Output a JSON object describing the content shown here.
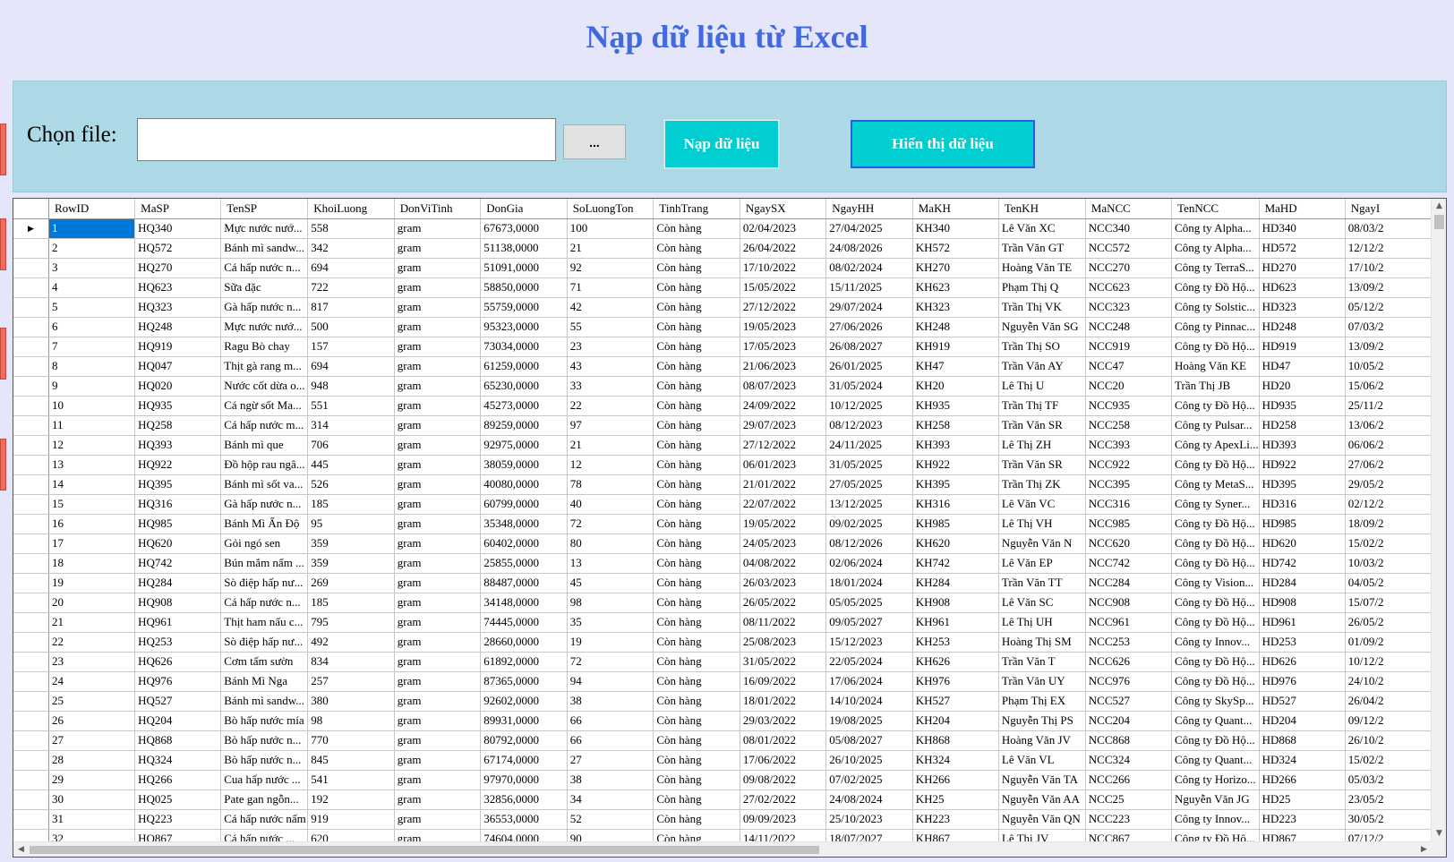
{
  "window": {
    "title": "Nạp dữ liệu từ Excel"
  },
  "file_picker": {
    "label": "Chọn file:",
    "value": "",
    "browse_label": "..."
  },
  "actions": {
    "load_label": "Nạp dữ liệu",
    "show_label": "Hiển thị dữ liệu"
  },
  "colors": {
    "background": "#e6e6fa",
    "title": "#4169e1",
    "panel": "#add8e6",
    "button": "#00ced1",
    "selection": "#0078d7"
  },
  "grid": {
    "columns": [
      "RowID",
      "MaSP",
      "TenSP",
      "KhoiLuong",
      "DonViTinh",
      "DonGia",
      "SoLuongTon",
      "TinhTrang",
      "NgaySX",
      "NgayHH",
      "MaKH",
      "TenKH",
      "MaNCC",
      "TenNCC",
      "MaHD",
      "NgayI"
    ],
    "rows": [
      [
        "1",
        "HQ340",
        "Mực nước nướ...",
        "558",
        "gram",
        "67673,0000",
        "100",
        "Còn hàng",
        "02/04/2023",
        "27/04/2025",
        "KH340",
        "Lê Văn XC",
        "NCC340",
        "Công ty Alpha...",
        "HD340",
        "08/03/2"
      ],
      [
        "2",
        "HQ572",
        "Bánh mì sandw...",
        "342",
        "gram",
        "51138,0000",
        "21",
        "Còn hàng",
        "26/04/2022",
        "24/08/2026",
        "KH572",
        "Trần Văn GT",
        "NCC572",
        "Công ty Alpha...",
        "HD572",
        "12/12/2"
      ],
      [
        "3",
        "HQ270",
        "Cá hấp nước n...",
        "694",
        "gram",
        "51091,0000",
        "92",
        "Còn hàng",
        "17/10/2022",
        "08/02/2024",
        "KH270",
        "Hoàng Văn TE",
        "NCC270",
        "Công ty TerraS...",
        "HD270",
        "17/10/2"
      ],
      [
        "4",
        "HQ623",
        "Sữa đặc",
        "722",
        "gram",
        "58850,0000",
        "71",
        "Còn hàng",
        "15/05/2022",
        "15/11/2025",
        "KH623",
        "Phạm Thị Q",
        "NCC623",
        "Công ty Đồ Hộ...",
        "HD623",
        "13/09/2"
      ],
      [
        "5",
        "HQ323",
        "Gà hấp nước n...",
        "817",
        "gram",
        "55759,0000",
        "42",
        "Còn hàng",
        "27/12/2022",
        "29/07/2024",
        "KH323",
        "Trần Thị VK",
        "NCC323",
        "Công ty Solstic...",
        "HD323",
        "05/12/2"
      ],
      [
        "6",
        "HQ248",
        "Mực nước nướ...",
        "500",
        "gram",
        "95323,0000",
        "55",
        "Còn hàng",
        "19/05/2023",
        "27/06/2026",
        "KH248",
        "Nguyễn Văn SG",
        "NCC248",
        "Công ty Pinnac...",
        "HD248",
        "07/03/2"
      ],
      [
        "7",
        "HQ919",
        "Ragu Bò chay",
        "157",
        "gram",
        "73034,0000",
        "23",
        "Còn hàng",
        "17/05/2023",
        "26/08/2027",
        "KH919",
        "Trần Thị SO",
        "NCC919",
        "Công ty Đồ Hộ...",
        "HD919",
        "13/09/2"
      ],
      [
        "8",
        "HQ047",
        "Thịt gà rang m...",
        "694",
        "gram",
        "61259,0000",
        "43",
        "Còn hàng",
        "21/06/2023",
        "26/01/2025",
        "KH47",
        "Trần Văn AY",
        "NCC47",
        "Hoàng Văn KE",
        "HD47",
        "10/05/2"
      ],
      [
        "9",
        "HQ020",
        "Nước cốt dừa o...",
        "948",
        "gram",
        "65230,0000",
        "33",
        "Còn hàng",
        "08/07/2023",
        "31/05/2024",
        "KH20",
        "Lê Thị U",
        "NCC20",
        "Trần Thị JB",
        "HD20",
        "15/06/2"
      ],
      [
        "10",
        "HQ935",
        "Cá ngừ sốt Ma...",
        "551",
        "gram",
        "45273,0000",
        "22",
        "Còn hàng",
        "24/09/2022",
        "10/12/2025",
        "KH935",
        "Trần Thị TF",
        "NCC935",
        "Công ty Đồ Hộ...",
        "HD935",
        "25/11/2"
      ],
      [
        "11",
        "HQ258",
        "Cá hấp nước m...",
        "314",
        "gram",
        "89259,0000",
        "97",
        "Còn hàng",
        "29/07/2023",
        "08/12/2023",
        "KH258",
        "Trần Văn SR",
        "NCC258",
        "Công ty Pulsar...",
        "HD258",
        "13/06/2"
      ],
      [
        "12",
        "HQ393",
        "Bánh mì que",
        "706",
        "gram",
        "92975,0000",
        "21",
        "Còn hàng",
        "27/12/2022",
        "24/11/2025",
        "KH393",
        "Lê Thị ZH",
        "NCC393",
        "Công ty ApexLi...",
        "HD393",
        "06/06/2"
      ],
      [
        "13",
        "HQ922",
        "Đồ hộp rau ngâ...",
        "445",
        "gram",
        "38059,0000",
        "12",
        "Còn hàng",
        "06/01/2023",
        "31/05/2025",
        "KH922",
        "Trần Văn SR",
        "NCC922",
        "Công ty Đồ Hộ...",
        "HD922",
        "27/06/2"
      ],
      [
        "14",
        "HQ395",
        "Bánh mì sốt va...",
        "526",
        "gram",
        "40080,0000",
        "78",
        "Còn hàng",
        "21/01/2022",
        "27/05/2025",
        "KH395",
        "Trần Thị ZK",
        "NCC395",
        "Công ty MetaS...",
        "HD395",
        "29/05/2"
      ],
      [
        "15",
        "HQ316",
        "Gà hấp nước n...",
        "185",
        "gram",
        "60799,0000",
        "40",
        "Còn hàng",
        "22/07/2022",
        "13/12/2025",
        "KH316",
        "Lê Văn VC",
        "NCC316",
        "Công ty Syner...",
        "HD316",
        "02/12/2"
      ],
      [
        "16",
        "HQ985",
        "Bánh Mì Ấn Độ",
        "95",
        "gram",
        "35348,0000",
        "72",
        "Còn hàng",
        "19/05/2022",
        "09/02/2025",
        "KH985",
        "Lê Thị VH",
        "NCC985",
        "Công ty Đồ Hộ...",
        "HD985",
        "18/09/2"
      ],
      [
        "17",
        "HQ620",
        "Gỏi ngó sen",
        "359",
        "gram",
        "60402,0000",
        "80",
        "Còn hàng",
        "24/05/2023",
        "08/12/2026",
        "KH620",
        "Nguyễn Văn N",
        "NCC620",
        "Công ty Đồ Hộ...",
        "HD620",
        "15/02/2"
      ],
      [
        "18",
        "HQ742",
        "Bún mắm nấm ...",
        "359",
        "gram",
        "25855,0000",
        "13",
        "Còn hàng",
        "04/08/2022",
        "02/06/2024",
        "KH742",
        "Lê Văn EP",
        "NCC742",
        "Công ty Đồ Hộ...",
        "HD742",
        "10/03/2"
      ],
      [
        "19",
        "HQ284",
        "Sò điệp hấp nư...",
        "269",
        "gram",
        "88487,0000",
        "45",
        "Còn hàng",
        "26/03/2023",
        "18/01/2024",
        "KH284",
        "Trần Văn TT",
        "NCC284",
        "Công ty Vision...",
        "HD284",
        "04/05/2"
      ],
      [
        "20",
        "HQ908",
        "Cá hấp nước n...",
        "185",
        "gram",
        "34148,0000",
        "98",
        "Còn hàng",
        "26/05/2022",
        "05/05/2025",
        "KH908",
        "Lê Văn SC",
        "NCC908",
        "Công ty Đồ Hộ...",
        "HD908",
        "15/07/2"
      ],
      [
        "21",
        "HQ961",
        "Thịt ham nấu c...",
        "795",
        "gram",
        "74445,0000",
        "35",
        "Còn hàng",
        "08/11/2022",
        "09/05/2027",
        "KH961",
        "Lê Thị UH",
        "NCC961",
        "Công ty Đồ Hộ...",
        "HD961",
        "26/05/2"
      ],
      [
        "22",
        "HQ253",
        "Sò điệp hấp nư...",
        "492",
        "gram",
        "28660,0000",
        "19",
        "Còn hàng",
        "25/08/2023",
        "15/12/2023",
        "KH253",
        "Hoàng Thị SM",
        "NCC253",
        "Công ty Innov...",
        "HD253",
        "01/09/2"
      ],
      [
        "23",
        "HQ626",
        "Cơm tấm sườn",
        "834",
        "gram",
        "61892,0000",
        "72",
        "Còn hàng",
        "31/05/2022",
        "22/05/2024",
        "KH626",
        "Trần Văn T",
        "NCC626",
        "Công ty Đồ Hộ...",
        "HD626",
        "10/12/2"
      ],
      [
        "24",
        "HQ976",
        "Bánh Mì Nga",
        "257",
        "gram",
        "87365,0000",
        "94",
        "Còn hàng",
        "16/09/2022",
        "17/06/2024",
        "KH976",
        "Trần Văn UY",
        "NCC976",
        "Công ty Đồ Hộ...",
        "HD976",
        "24/10/2"
      ],
      [
        "25",
        "HQ527",
        "Bánh mì sandw...",
        "380",
        "gram",
        "92602,0000",
        "38",
        "Còn hàng",
        "18/01/2022",
        "14/10/2024",
        "KH527",
        "Phạm Thị EX",
        "NCC527",
        "Công ty SkySp...",
        "HD527",
        "26/04/2"
      ],
      [
        "26",
        "HQ204",
        "Bò hấp nước mía",
        "98",
        "gram",
        "89931,0000",
        "66",
        "Còn hàng",
        "29/03/2022",
        "19/08/2025",
        "KH204",
        "Nguyễn Thị PS",
        "NCC204",
        "Công ty Quant...",
        "HD204",
        "09/12/2"
      ],
      [
        "27",
        "HQ868",
        "Bò hấp nước n...",
        "770",
        "gram",
        "80792,0000",
        "66",
        "Còn hàng",
        "08/01/2022",
        "05/08/2027",
        "KH868",
        "Hoàng Văn JV",
        "NCC868",
        "Công ty Đồ Hộ...",
        "HD868",
        "26/10/2"
      ],
      [
        "28",
        "HQ324",
        "Bò hấp nước n...",
        "845",
        "gram",
        "67174,0000",
        "27",
        "Còn hàng",
        "17/06/2022",
        "26/10/2025",
        "KH324",
        "Lê Văn VL",
        "NCC324",
        "Công ty Quant...",
        "HD324",
        "15/02/2"
      ],
      [
        "29",
        "HQ266",
        "Cua hấp nước ...",
        "541",
        "gram",
        "97970,0000",
        "38",
        "Còn hàng",
        "09/08/2022",
        "07/02/2025",
        "KH266",
        "Nguyễn Văn TA",
        "NCC266",
        "Công ty Horizo...",
        "HD266",
        "05/03/2"
      ],
      [
        "30",
        "HQ025",
        "Pate gan ngỗn...",
        "192",
        "gram",
        "32856,0000",
        "34",
        "Còn hàng",
        "27/02/2022",
        "24/08/2024",
        "KH25",
        "Nguyễn Văn AA",
        "NCC25",
        "Nguyễn Văn JG",
        "HD25",
        "23/05/2"
      ],
      [
        "31",
        "HQ223",
        "Cá hấp nước nấm",
        "919",
        "gram",
        "36553,0000",
        "52",
        "Còn hàng",
        "09/09/2023",
        "25/10/2023",
        "KH223",
        "Nguyễn Văn QN",
        "NCC223",
        "Công ty Innov...",
        "HD223",
        "30/05/2"
      ],
      [
        "32",
        "HQ867",
        "Cá hấp nước ...",
        "620",
        "gram",
        "74604,0000",
        "90",
        "Còn hàng",
        "14/11/2022",
        "18/07/2027",
        "KH867",
        "Lê Thị JV",
        "NCC867",
        "Công ty Đồ Hộ...",
        "HD867",
        "07/12/2"
      ]
    ]
  }
}
